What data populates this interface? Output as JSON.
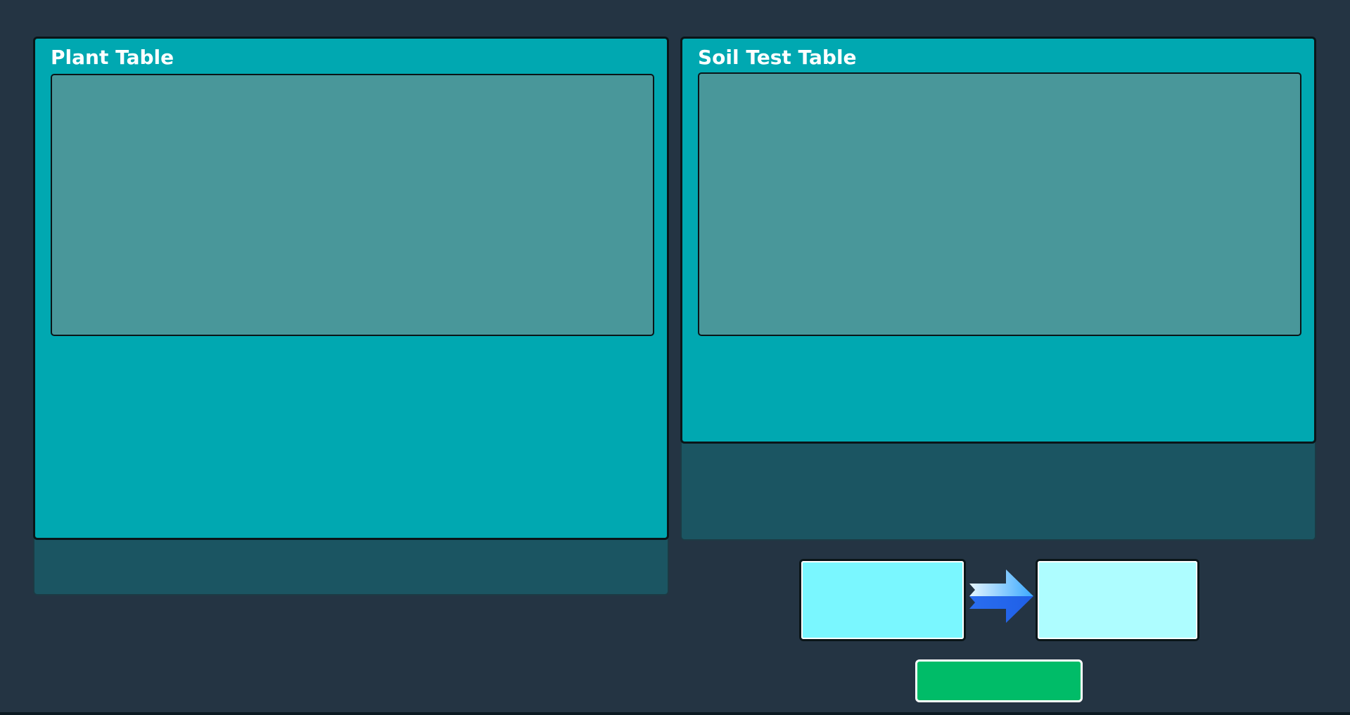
{
  "plant_panel": {
    "title": "Plant Table"
  },
  "soil_panel": {
    "title": "Soil Test Table"
  },
  "controls": {
    "left_box_value": "",
    "right_box_value": "",
    "action_button_label": "",
    "arrow_icon": "arrow-right-icon"
  },
  "colors": {
    "background": "#243443",
    "panel": "#00a8b1",
    "table_area": "#49979a",
    "panel_base": "#1b5562",
    "left_box": "#7af7ff",
    "right_box": "#aefdff",
    "action_button": "#00bc68"
  }
}
